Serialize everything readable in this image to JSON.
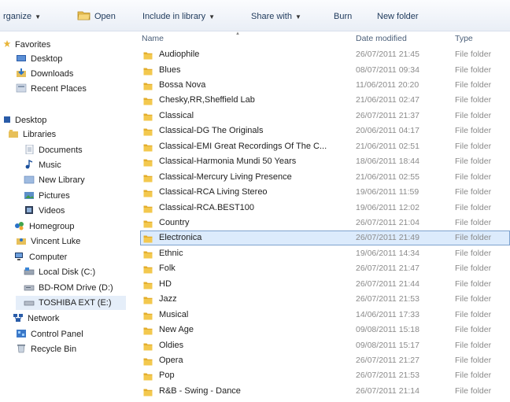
{
  "toolbar": {
    "organize": "rganize",
    "open": "Open",
    "include": "Include in library",
    "share": "Share with",
    "burn": "Burn",
    "new_folder": "New folder"
  },
  "nav": {
    "favorites": "Favorites",
    "desktop_fav": "Desktop",
    "downloads": "Downloads",
    "recent": "Recent Places",
    "desktop": "Desktop",
    "libraries": "Libraries",
    "documents": "Documents",
    "music": "Music",
    "new_library": "New Library",
    "pictures": "Pictures",
    "videos": "Videos",
    "homegroup": "Homegroup",
    "user": "Vincent Luke",
    "computer": "Computer",
    "local_disk": "Local Disk (C:)",
    "bdrom": "BD-ROM Drive (D:)",
    "toshiba": "TOSHIBA EXT (E:)",
    "network": "Network",
    "control_panel": "Control Panel",
    "recycle_bin": "Recycle Bin"
  },
  "columns": {
    "name": "Name",
    "date": "Date modified",
    "type": "Type"
  },
  "files": [
    {
      "name": "Audiophile",
      "date": "26/07/2011 21:45",
      "type": "File folder"
    },
    {
      "name": "Blues",
      "date": "08/07/2011 09:34",
      "type": "File folder"
    },
    {
      "name": "Bossa Nova",
      "date": "11/06/2011 20:20",
      "type": "File folder"
    },
    {
      "name": "Chesky,RR,Sheffield Lab",
      "date": "21/06/2011 02:47",
      "type": "File folder"
    },
    {
      "name": "Classical",
      "date": "26/07/2011 21:37",
      "type": "File folder"
    },
    {
      "name": "Classical-DG The Originals",
      "date": "20/06/2011 04:17",
      "type": "File folder"
    },
    {
      "name": "Classical-EMI Great Recordings Of The C...",
      "date": "21/06/2011 02:51",
      "type": "File folder"
    },
    {
      "name": "Classical-Harmonia Mundi 50 Years",
      "date": "18/06/2011 18:44",
      "type": "File folder"
    },
    {
      "name": "Classical-Mercury Living Presence",
      "date": "21/06/2011 02:55",
      "type": "File folder"
    },
    {
      "name": "Classical-RCA Living Stereo",
      "date": "19/06/2011 11:59",
      "type": "File folder"
    },
    {
      "name": "Classical-RCA.BEST100",
      "date": "19/06/2011 12:02",
      "type": "File folder"
    },
    {
      "name": "Country",
      "date": "26/07/2011 21:04",
      "type": "File folder"
    },
    {
      "name": "Electronica",
      "date": "26/07/2011 21:49",
      "type": "File folder"
    },
    {
      "name": "Ethnic",
      "date": "19/06/2011 14:34",
      "type": "File folder"
    },
    {
      "name": "Folk",
      "date": "26/07/2011 21:47",
      "type": "File folder"
    },
    {
      "name": "HD",
      "date": "26/07/2011 21:44",
      "type": "File folder"
    },
    {
      "name": "Jazz",
      "date": "26/07/2011 21:53",
      "type": "File folder"
    },
    {
      "name": "Musical",
      "date": "14/06/2011 17:33",
      "type": "File folder"
    },
    {
      "name": "New Age",
      "date": "09/08/2011 15:18",
      "type": "File folder"
    },
    {
      "name": "Oldies",
      "date": "09/08/2011 15:17",
      "type": "File folder"
    },
    {
      "name": "Opera",
      "date": "26/07/2011 21:27",
      "type": "File folder"
    },
    {
      "name": "Pop",
      "date": "26/07/2011 21:53",
      "type": "File folder"
    },
    {
      "name": "R&B - Swing - Dance",
      "date": "26/07/2011 21:14",
      "type": "File folder"
    }
  ],
  "selected_file": "Electronica",
  "colors": {
    "folder": "#f0c040",
    "selection": "#dcebfc",
    "selection_border": "#7da2ce",
    "link": "#1e395b"
  }
}
